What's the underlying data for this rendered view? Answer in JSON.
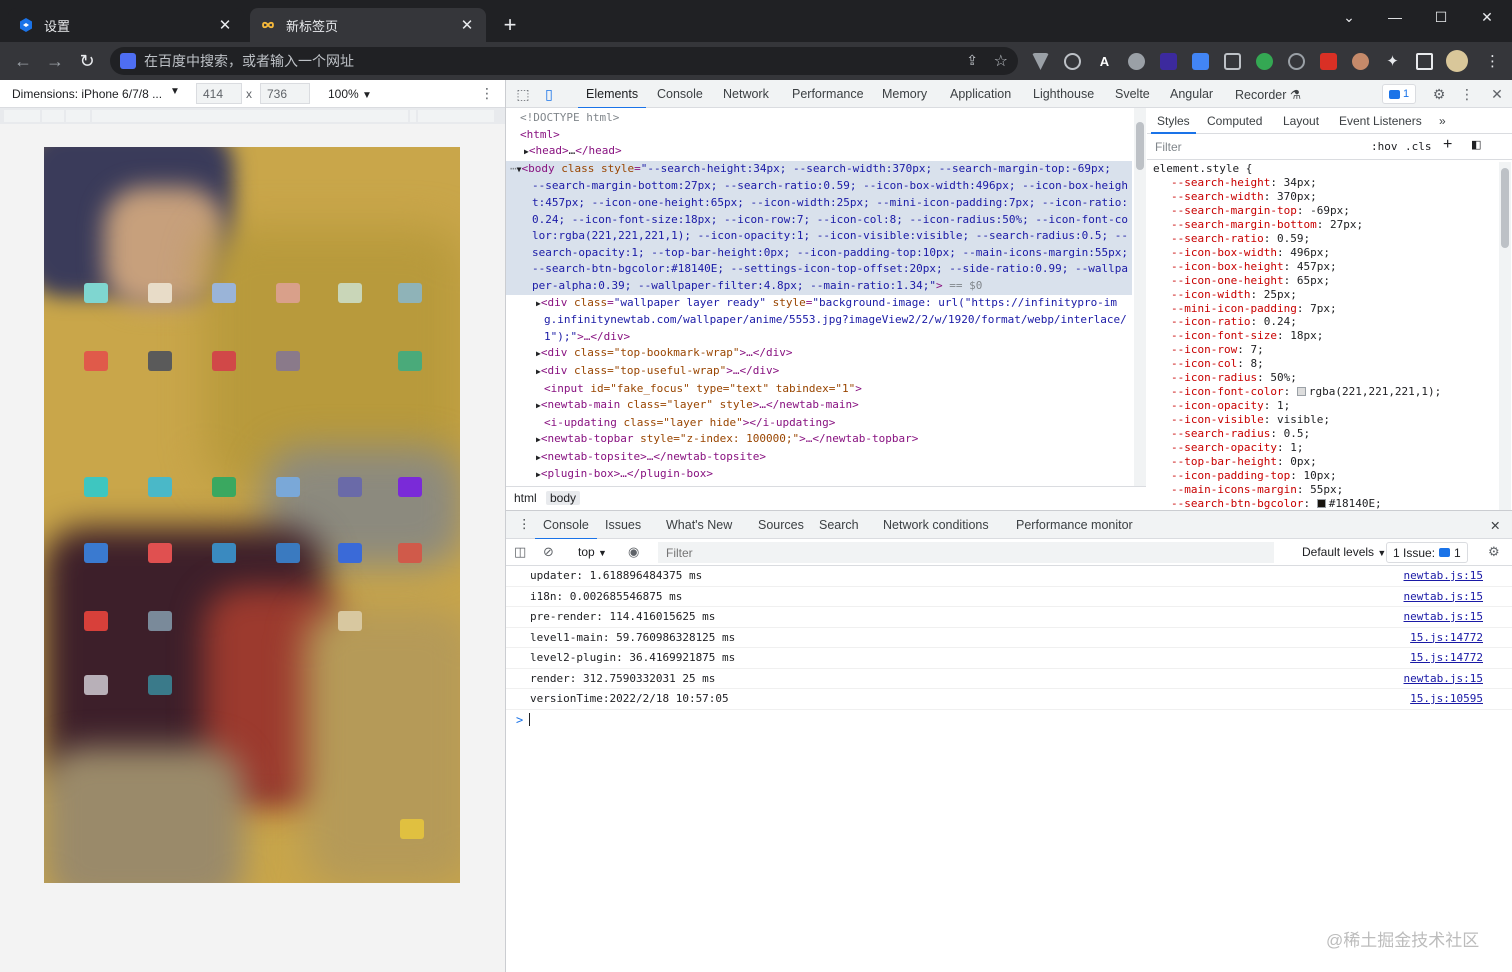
{
  "browser": {
    "tabs": [
      {
        "title": "设置",
        "icon": "settings-icon",
        "active": false
      },
      {
        "title": "新标签页",
        "icon": "infinity-icon",
        "active": true
      }
    ],
    "omnibox_placeholder": "在百度中搜索，或者输入一个网址"
  },
  "device_bar": {
    "dimensions_label": "Dimensions: iPhone 6/7/8 ...",
    "width": "414",
    "height": "736",
    "times": "x",
    "zoom": "100%"
  },
  "devtools": {
    "tabs": [
      "Elements",
      "Console",
      "Network",
      "Performance",
      "Memory",
      "Application",
      "Lighthouse",
      "Svelte",
      "Angular",
      "Recorder"
    ],
    "selected_tab": "Elements",
    "issues_count": "1",
    "dom": {
      "doctype": "<!DOCTYPE html>",
      "html_open": "<html>",
      "head_tag": "<head>",
      "head_ellipsis": "…",
      "head_close": "</head>",
      "body_lines": [
        "--search-height:34px; --search-width:370px; --search-margin-top:-69px;",
        "--search-margin-bottom:27px; --search-ratio:0.59; --icon-box-width:496px; --icon-box-heigh",
        "t:457px; --icon-one-height:65px; --icon-width:25px; --mini-icon-padding:7px; --icon-ratio:",
        "0.24; --icon-font-size:18px; --icon-row:7; --icon-col:8; --icon-radius:50%; --icon-font-co",
        "lor:rgba(221,221,221,1); --icon-opacity:1; --icon-visible:visible; --search-radius:0.5; --",
        "search-opacity:1; --top-bar-height:0px; --icon-padding-top:10px; --main-icons-margin:55px;",
        "--search-btn-bgcolor:#18140E; --settings-icon-top-offset:20px; --side-ratio:0.99; --wallpa",
        "per-alpha:0.39; --wallpaper-filter:4.8px; --main-ratio:1.34;"
      ],
      "body_tag": "<body",
      "class_attr": "class",
      "style_attr": "style",
      "selected_marker": "== $0",
      "wallpaper_line1": "\"https://infinitypro-im",
      "wallpaper_line2": "g.infinitynewtab.com/wallpaper/anime/5553.jpg?imageView2/2/w/1920/format/webp/interlace/",
      "wallpaper_line3": "1\");",
      "children": [
        {
          "tag": "div",
          "attrs": "class=\"top-bookmark-wrap\"",
          "collapsed": true,
          "close": "</div>"
        },
        {
          "tag": "div",
          "attrs": "class=\"top-useful-wrap\"",
          "collapsed": true,
          "close": "</div>"
        },
        {
          "tag": "input",
          "attrs": "id=\"fake_focus\" type=\"text\" tabindex=\"1\"",
          "collapsed": false,
          "close": ""
        },
        {
          "tag": "newtab-main",
          "attrs": "class=\"layer\" style",
          "collapsed": true,
          "close": "</newtab-main>"
        },
        {
          "tag": "i-updating",
          "attrs": "class=\"layer hide\"",
          "collapsed": false,
          "close": "</i-updating>"
        },
        {
          "tag": "newtab-topbar",
          "attrs": "style=\"z-index: 100000;\"",
          "collapsed": true,
          "close": "</newtab-topbar>"
        },
        {
          "tag": "newtab-topsite",
          "attrs": "",
          "collapsed": true,
          "close": "</newtab-topsite>"
        },
        {
          "tag": "plugin-box",
          "attrs": "",
          "collapsed": true,
          "close": "</plugin-box>"
        }
      ]
    },
    "breadcrumbs": [
      "html",
      "body"
    ],
    "styles": {
      "tabs": [
        "Styles",
        "Computed",
        "Layout",
        "Event Listeners"
      ],
      "filter_placeholder": "Filter",
      "hov": ":hov",
      "cls": ".cls",
      "selector": "element.style {",
      "props": [
        {
          "name": "--search-height",
          "value": "34px;"
        },
        {
          "name": "--search-width",
          "value": "370px;"
        },
        {
          "name": "--search-margin-top",
          "value": "-69px;"
        },
        {
          "name": "--search-margin-bottom",
          "value": "27px;"
        },
        {
          "name": "--search-ratio",
          "value": "0.59;"
        },
        {
          "name": "--icon-box-width",
          "value": "496px;"
        },
        {
          "name": "--icon-box-height",
          "value": "457px;"
        },
        {
          "name": "--icon-one-height",
          "value": "65px;"
        },
        {
          "name": "--icon-width",
          "value": "25px;"
        },
        {
          "name": "--mini-icon-padding",
          "value": "7px;"
        },
        {
          "name": "--icon-ratio",
          "value": "0.24;"
        },
        {
          "name": "--icon-font-size",
          "value": "18px;"
        },
        {
          "name": "--icon-row",
          "value": "7;"
        },
        {
          "name": "--icon-col",
          "value": "8;"
        },
        {
          "name": "--icon-radius",
          "value": "50%;"
        },
        {
          "name": "--icon-font-color",
          "value": "rgba(221,221,221,1);",
          "swatch": "#dddddd"
        },
        {
          "name": "--icon-opacity",
          "value": "1;"
        },
        {
          "name": "--icon-visible",
          "value": "visible;"
        },
        {
          "name": "--search-radius",
          "value": "0.5;"
        },
        {
          "name": "--search-opacity",
          "value": "1;"
        },
        {
          "name": "--top-bar-height",
          "value": "0px;"
        },
        {
          "name": "--icon-padding-top",
          "value": "10px;"
        },
        {
          "name": "--main-icons-margin",
          "value": "55px;"
        },
        {
          "name": "--search-btn-bgcolor",
          "value": "#18140E;",
          "swatch": "#18140e"
        }
      ]
    },
    "drawer": {
      "tabs": [
        "Console",
        "Issues",
        "What's New",
        "Sources",
        "Search",
        "Network conditions",
        "Performance monitor"
      ],
      "selected": "Console",
      "context": "top",
      "filter_placeholder": "Filter",
      "levels": "Default levels",
      "issues_label": "1 Issue:",
      "issues_count": "1",
      "logs": [
        {
          "text": "updater: 1.618896484375 ms",
          "source": "newtab.js:15"
        },
        {
          "text": "i18n: 0.002685546875 ms",
          "source": "newtab.js:15"
        },
        {
          "text": "pre-render: 114.416015625 ms",
          "source": "newtab.js:15"
        },
        {
          "text": "level1-main: 59.760986328125 ms",
          "source": "15.js:14772"
        },
        {
          "text": "level2-plugin: 36.4169921875 ms",
          "source": "15.js:14772"
        },
        {
          "text": "render: 312.7590332031 25 ms",
          "source": "newtab.js:15"
        },
        {
          "text": "versionTime:2022/2/18 10:57:05",
          "source": "15.js:10595"
        }
      ],
      "prompt": ">"
    }
  },
  "watermark": "@稀土掘金技术社区",
  "colors": {
    "accent": "#1a73e8",
    "tag": "#881280",
    "attr_name": "#994500",
    "attr_value": "#1a1aa6",
    "css_prop": "#c80000"
  }
}
